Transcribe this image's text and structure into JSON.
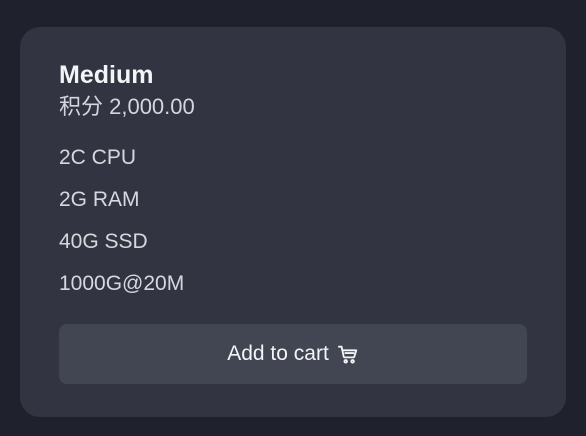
{
  "plan": {
    "name": "Medium",
    "price": "积分 2,000.00",
    "features": [
      "2C CPU",
      "2G RAM",
      "40G SSD",
      "1000G@20M"
    ],
    "add_to_cart_label": "Add to cart",
    "add_to_cart_icon": "shopping-cart-icon"
  },
  "colors": {
    "page_background": "#1f212c",
    "card_background": "#323541",
    "button_background": "#424552",
    "text_primary": "#f3f4f6"
  }
}
